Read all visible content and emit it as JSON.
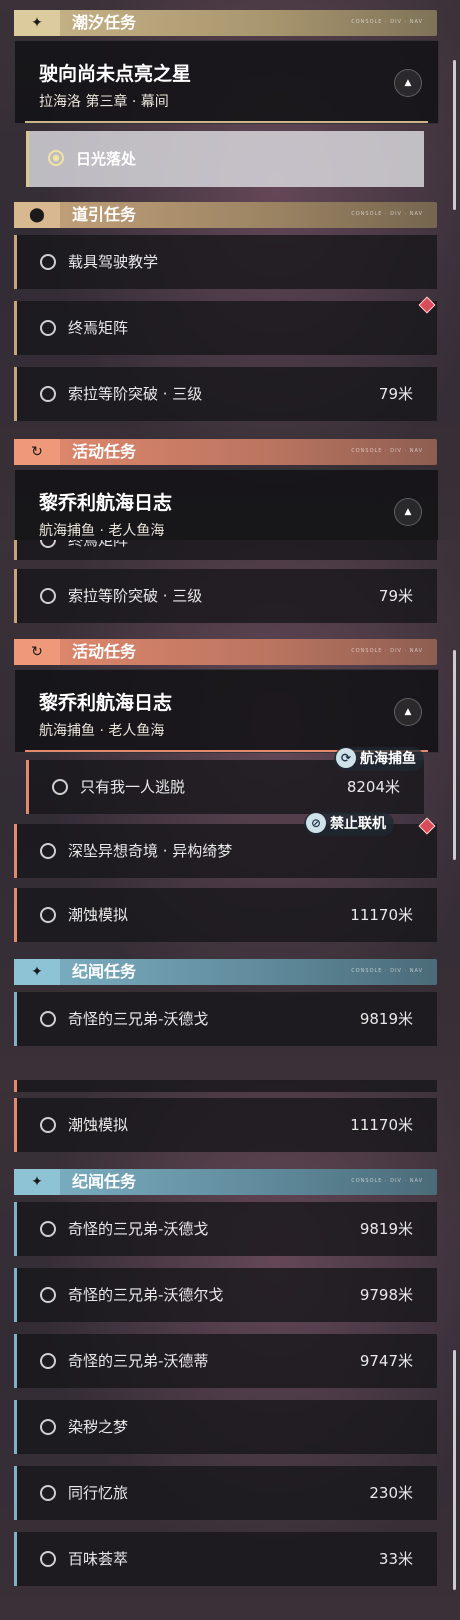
{
  "colors": {
    "tide": "#c9b589",
    "guide": "#c6a47c",
    "event": "#e38a6e",
    "lore": "#7fb2c6",
    "pin": "#d84c5a"
  },
  "category_tag": "CONSOLE · DIV · NAV",
  "panel1": {
    "tide_header": {
      "label": "潮汐任务",
      "icon": "sparkle-icon"
    },
    "tide_card": {
      "title": "驶向尚未点亮之星",
      "subtitle": "拉海洛 第三章 · 幕间"
    },
    "selected_task": {
      "label": "日光落处"
    },
    "guide_header": {
      "label": "道引任务",
      "icon": "map-pin-icon"
    },
    "guide_rows": [
      {
        "name": "载具驾驶教学",
        "distance": ""
      },
      {
        "name": "终焉矩阵",
        "distance": ""
      },
      {
        "name": "索拉等阶突破 · 三级",
        "distance": "79米"
      }
    ],
    "event_header": {
      "label": "活动任务",
      "icon": "refresh-icon"
    },
    "event_card": {
      "title": "黎乔利航海日志",
      "subtitle": "航海捕鱼 · 老人鱼海"
    }
  },
  "panel2": {
    "partial_row": "终焉矩阵",
    "guide_row": {
      "name": "索拉等阶突破 · 三级",
      "distance": "79米"
    },
    "event_header": {
      "label": "活动任务"
    },
    "event_card": {
      "title": "黎乔利航海日志",
      "subtitle": "航海捕鱼 · 老人鱼海"
    },
    "event_rows": [
      {
        "name": "只有我一人逃脱",
        "distance": "8204米"
      },
      {
        "name": "深坠异想奇境 · 异构绮梦",
        "distance": ""
      },
      {
        "name": "潮蚀模拟",
        "distance": "11170米"
      }
    ],
    "badges": {
      "fishing": "航海捕鱼",
      "no_coop": "禁止联机"
    },
    "lore_header": {
      "label": "纪闻任务"
    },
    "lore_rows": [
      {
        "name": "奇怪的三兄弟-沃德戈",
        "distance": "9819米"
      }
    ]
  },
  "panel3": {
    "event_rows": [
      {
        "name": "潮蚀模拟",
        "distance": "11170米"
      }
    ],
    "lore_header": {
      "label": "纪闻任务"
    },
    "lore_rows": [
      {
        "name": "奇怪的三兄弟-沃德戈",
        "distance": "9819米"
      },
      {
        "name": "奇怪的三兄弟-沃德尔戈",
        "distance": "9798米"
      },
      {
        "name": "奇怪的三兄弟-沃德蒂",
        "distance": "9747米"
      },
      {
        "name": "染秽之梦",
        "distance": ""
      },
      {
        "name": "同行忆旅",
        "distance": "230米"
      },
      {
        "name": "百味荟萃",
        "distance": "33米"
      }
    ]
  }
}
